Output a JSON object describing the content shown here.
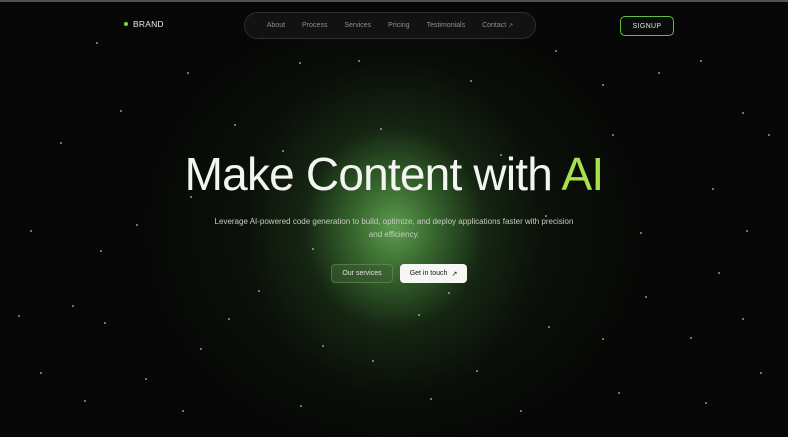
{
  "header": {
    "brand": "BRAND",
    "nav": [
      {
        "label": "About"
      },
      {
        "label": "Process"
      },
      {
        "label": "Services"
      },
      {
        "label": "Pricing"
      },
      {
        "label": "Testimonials"
      },
      {
        "label": "Contact",
        "icon": "arrow-up-right-icon",
        "icon_glyph": "↗"
      }
    ],
    "signup": "SIGNUP"
  },
  "hero": {
    "title_main": "Make Content with ",
    "title_accent": "AI",
    "subtitle": "Leverage AI-powered code generation to build, optimize, and deploy applications faster with precision and efficiency.",
    "primary_button": "Our services",
    "secondary_button": "Get in touch",
    "secondary_button_icon": "↗"
  },
  "colors": {
    "accent": "#a8e24a",
    "brand_dot": "#7ddb43",
    "signup_border": "#5cc13f",
    "background": "#060706"
  }
}
